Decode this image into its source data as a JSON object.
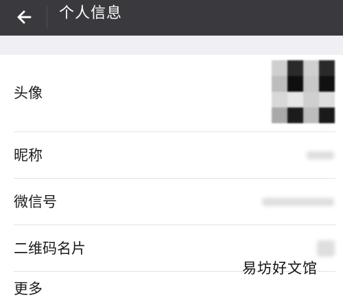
{
  "header": {
    "back_icon": "arrow-left-icon",
    "title": "个人信息",
    "bg_color": "#3a3a3e"
  },
  "rows": [
    {
      "label": "头像"
    },
    {
      "label": "昵称"
    },
    {
      "label": "微信号"
    },
    {
      "label": "二维码名片"
    },
    {
      "label": "更多"
    }
  ],
  "watermark": "易坊好文馆"
}
